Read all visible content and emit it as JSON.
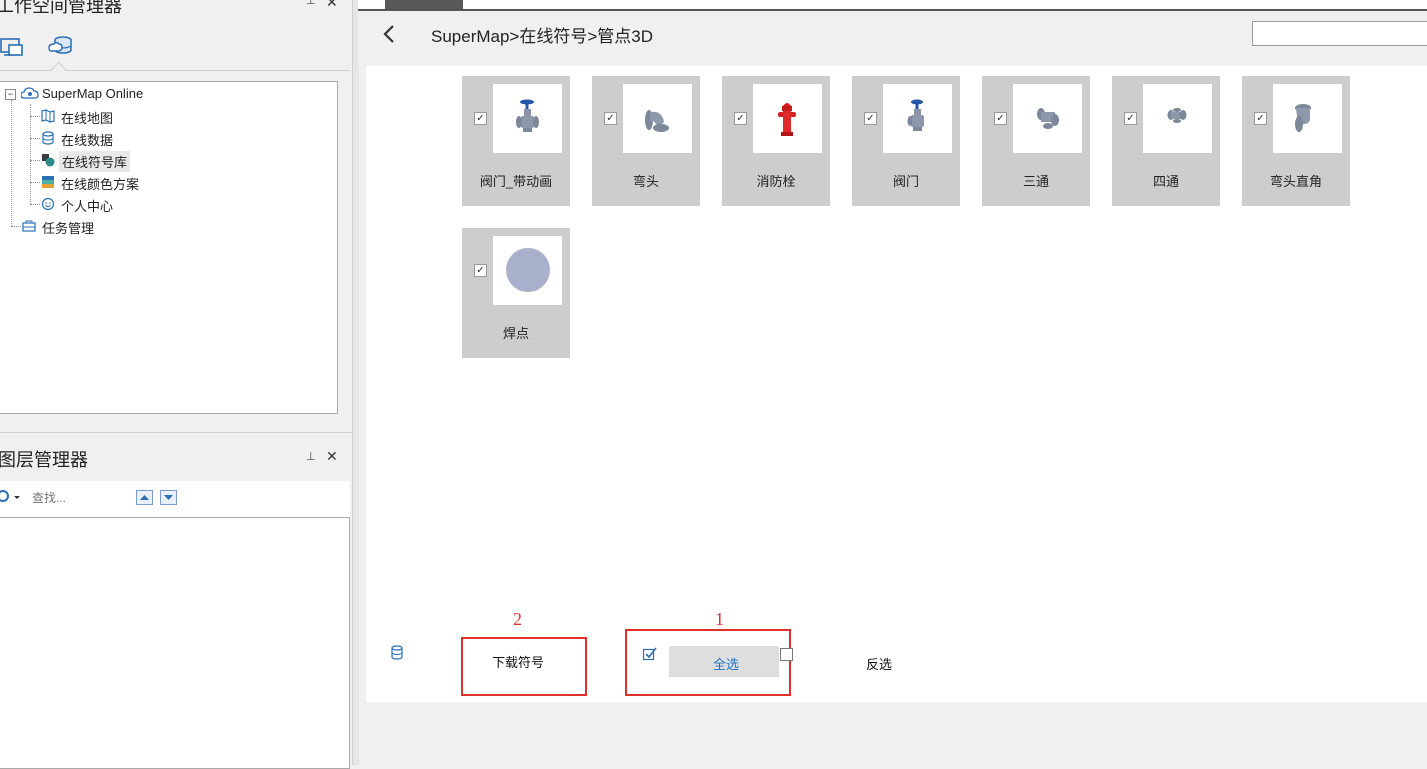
{
  "workspace_manager": {
    "title": "工作空间管理器",
    "tree": {
      "root_label": "SuperMap Online",
      "children": [
        {
          "label": "在线地图"
        },
        {
          "label": "在线数据"
        },
        {
          "label": "在线符号库"
        },
        {
          "label": "在线颜色方案"
        },
        {
          "label": "个人中心"
        }
      ],
      "task_label": "任务管理"
    }
  },
  "layer_manager": {
    "title": "图层管理器",
    "search_placeholder": "查找..."
  },
  "symbol_browser": {
    "breadcrumb": "SuperMap>在线符号>管点3D",
    "symbols": [
      {
        "name": "阀门_带动画",
        "checked": true,
        "icon": "valve-animated-icon"
      },
      {
        "name": "弯头",
        "checked": true,
        "icon": "elbow-icon"
      },
      {
        "name": "消防栓",
        "checked": true,
        "icon": "fire-hydrant-icon"
      },
      {
        "name": "阀门",
        "checked": true,
        "icon": "valve-icon"
      },
      {
        "name": "三通",
        "checked": true,
        "icon": "tee-icon"
      },
      {
        "name": "四通",
        "checked": true,
        "icon": "cross-icon"
      },
      {
        "name": "弯头直角",
        "checked": true,
        "icon": "right-angle-elbow-icon"
      },
      {
        "name": "焊点",
        "checked": true,
        "icon": "weld-point-icon"
      }
    ],
    "actions": {
      "download_label": "下载符号",
      "select_all_label": "全选",
      "invert_label": "反选"
    },
    "annotations": {
      "marker_1": "1",
      "marker_2": "2"
    }
  },
  "colors": {
    "card_bg": "#cdcdcd",
    "annotation_red": "#e0302a",
    "select_all_text": "#1e73c7"
  }
}
